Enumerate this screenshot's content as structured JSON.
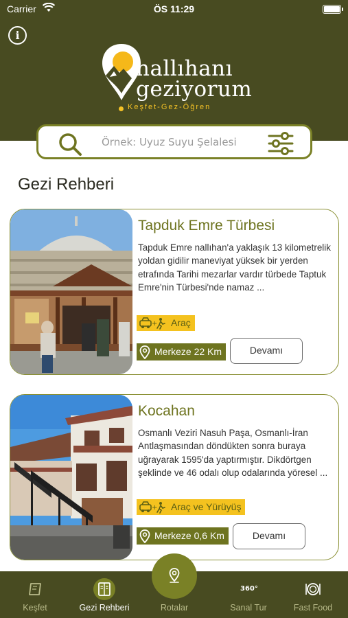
{
  "status_bar": {
    "carrier": "Carrier",
    "time": "ÖS 11:29"
  },
  "header": {
    "info_icon": "info-icon",
    "logo": {
      "line1": "nallıhanı",
      "line2": "geziyorum",
      "tagline": "Keşfet-Gez-Öğren"
    }
  },
  "search": {
    "placeholder": "Örnek: Uyuz Suyu Şelalesi",
    "search_icon": "search-icon",
    "filter_icon": "filter-icon"
  },
  "section": {
    "title": "Gezi Rehberi"
  },
  "cards": [
    {
      "title": "Tapduk Emre Türbesi",
      "description": "Tapduk Emre nallıhan'a yaklaşık 13 kilometrelik yoldan gidilir maneviyat yüksek bir yerden etrafında Tarihi mezarlar vardır türbede Taptuk Emre'nin Türbesi'nde namaz ...",
      "transport": "Araç",
      "distance": "Merkeze 22 Km",
      "more_label": "Devamı"
    },
    {
      "title": "Kocahan",
      "description": "Osmanlı Veziri Nasuh Paşa, Osmanlı-İran Antlaşmasından döndükten sonra buraya uğrayarak 1595'da yaptırmıştır. Dikdörtgen şeklinde ve 46 odalı olup odalarında yöresel ...",
      "transport": "Araç ve Yürüyüş",
      "distance": "Merkeze 0,6 Km",
      "more_label": "Devamı"
    }
  ],
  "bottom_nav": {
    "items": [
      {
        "label": "Keşfet",
        "icon": "map-icon"
      },
      {
        "label": "Gezi Rehberi",
        "icon": "guide-book-icon",
        "active": true
      },
      {
        "label": "Rotalar",
        "icon": "route-pin-icon"
      },
      {
        "label": "Sanal Tur",
        "icon": "360-icon",
        "icon_text": "360°"
      },
      {
        "label": "Fast Food",
        "icon": "plate-icon"
      }
    ]
  },
  "colors": {
    "header_bg": "#484b21",
    "accent_olive": "#7a8126",
    "title_olive": "#6e7420",
    "accent_yellow": "#f4c21f"
  }
}
